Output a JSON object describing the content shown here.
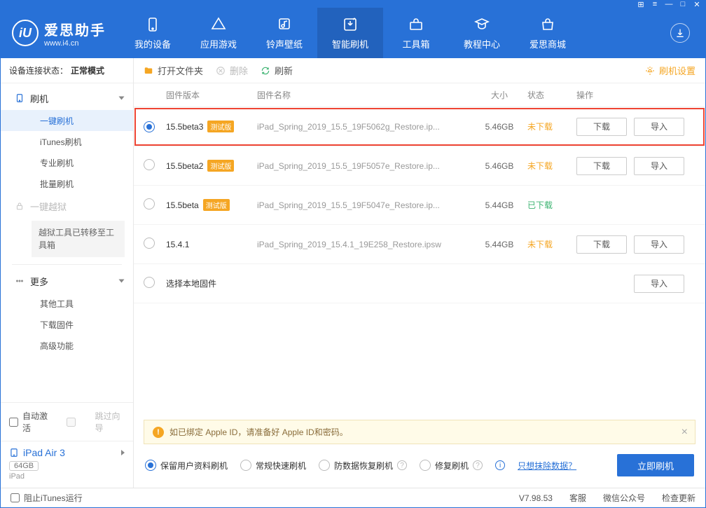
{
  "titlebar": {
    "icons": [
      "grid",
      "list",
      "min",
      "max",
      "close"
    ]
  },
  "brand": {
    "name": "爱思助手",
    "url": "www.i4.cn"
  },
  "nav": [
    {
      "id": "device",
      "label": "我的设备"
    },
    {
      "id": "apps",
      "label": "应用游戏"
    },
    {
      "id": "ring",
      "label": "铃声壁纸"
    },
    {
      "id": "flash",
      "label": "智能刷机",
      "active": true
    },
    {
      "id": "tools",
      "label": "工具箱"
    },
    {
      "id": "tutorial",
      "label": "教程中心"
    },
    {
      "id": "store",
      "label": "爱思商城"
    }
  ],
  "connection": {
    "label": "设备连接状态：",
    "mode": "正常模式"
  },
  "sidebar": {
    "group_flash": "刷机",
    "items_flash": [
      {
        "id": "one",
        "label": "一键刷机",
        "active": true
      },
      {
        "id": "itunes",
        "label": "iTunes刷机"
      },
      {
        "id": "pro",
        "label": "专业刷机"
      },
      {
        "id": "batch",
        "label": "批量刷机"
      }
    ],
    "group_jb": "一键越狱",
    "jb_note": "越狱工具已转移至工具箱",
    "group_more": "更多",
    "items_more": [
      {
        "id": "other",
        "label": "其他工具"
      },
      {
        "id": "dlfw",
        "label": "下载固件"
      },
      {
        "id": "adv",
        "label": "高级功能"
      }
    ],
    "auto_activate": "自动激活",
    "skip_guide": "跳过向导",
    "device": {
      "name": "iPad Air 3",
      "storage": "64GB",
      "type": "iPad"
    }
  },
  "toolbar": {
    "open": "打开文件夹",
    "delete": "删除",
    "refresh": "刷新",
    "settings": "刷机设置"
  },
  "table": {
    "headers": {
      "version": "固件版本",
      "name": "固件名称",
      "size": "大小",
      "status": "状态",
      "ops": "操作"
    },
    "btn_download": "下载",
    "btn_import": "导入",
    "beta_tag": "测试版",
    "rows": [
      {
        "selected": true,
        "highlight": true,
        "version": "15.5beta3",
        "beta": true,
        "name": "iPad_Spring_2019_15.5_19F5062g_Restore.ip...",
        "size": "5.46GB",
        "status": "未下载",
        "status_cls": "undl",
        "dl": true,
        "imp": true
      },
      {
        "selected": false,
        "version": "15.5beta2",
        "beta": true,
        "name": "iPad_Spring_2019_15.5_19F5057e_Restore.ip...",
        "size": "5.46GB",
        "status": "未下载",
        "status_cls": "undl",
        "dl": true,
        "imp": true
      },
      {
        "selected": false,
        "version": "15.5beta",
        "beta": true,
        "name": "iPad_Spring_2019_15.5_19F5047e_Restore.ip...",
        "size": "5.44GB",
        "status": "已下载",
        "status_cls": "dl",
        "dl": false,
        "imp": false
      },
      {
        "selected": false,
        "version": "15.4.1",
        "beta": false,
        "name": "iPad_Spring_2019_15.4.1_19E258_Restore.ipsw",
        "size": "5.44GB",
        "status": "未下载",
        "status_cls": "undl",
        "dl": true,
        "imp": true
      },
      {
        "selected": false,
        "version": "选择本地固件",
        "beta": false,
        "name": "",
        "size": "",
        "status": "",
        "status_cls": "",
        "dl": false,
        "imp": true
      }
    ]
  },
  "banner": {
    "text": "如已绑定 Apple ID，请准备好 Apple ID和密码。"
  },
  "flash_opts": {
    "keep": "保留用户资料刷机",
    "normal": "常规快速刷机",
    "antidata": "防数据恢复刷机",
    "repair": "修复刷机",
    "erase_link": "只想抹除数据？",
    "go": "立即刷机"
  },
  "statusbar": {
    "block_itunes": "阻止iTunes运行",
    "version": "V7.98.53",
    "service": "客服",
    "wechat": "微信公众号",
    "update": "检查更新"
  }
}
